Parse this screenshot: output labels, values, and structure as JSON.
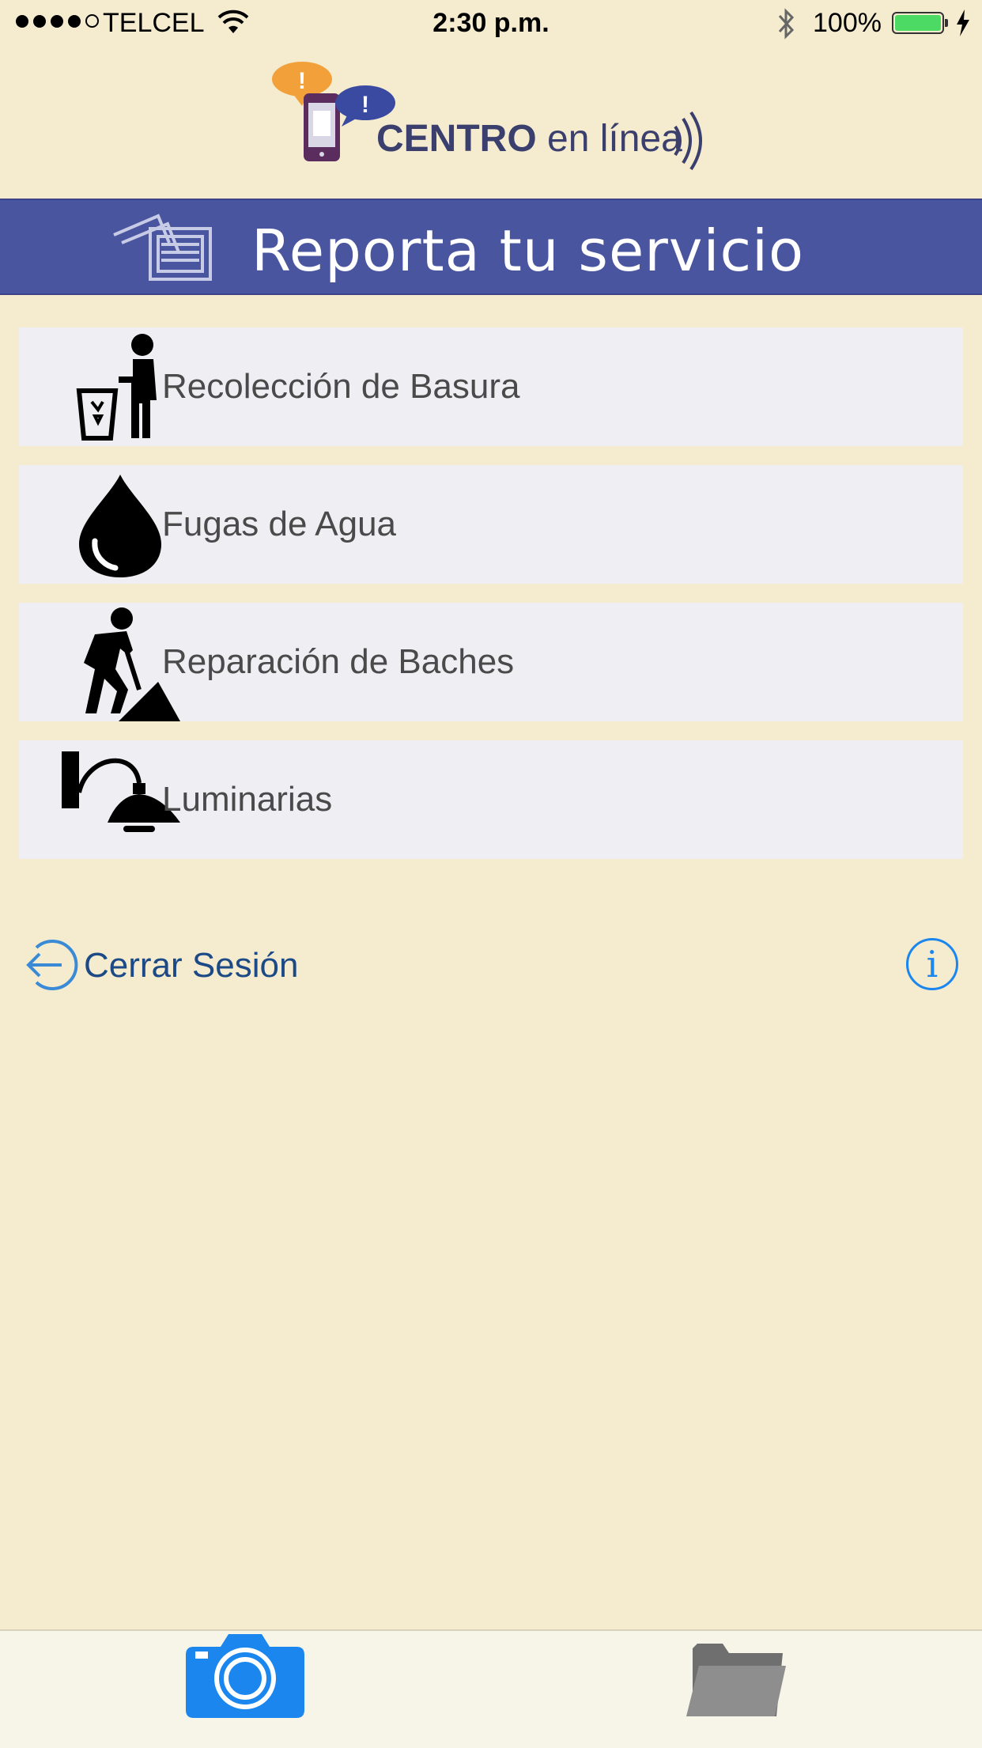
{
  "status_bar": {
    "carrier": "TELCEL",
    "time": "2:30 p.m.",
    "battery": "100%",
    "signal_bars_filled": 4,
    "signal_bars_total": 5
  },
  "header": {
    "logo_brand": "CENTRO",
    "logo_suffix": " en línea",
    "logo_icon": "phone-speech-bubbles-icon"
  },
  "banner": {
    "title": "Reporta tu servicio",
    "icon": "documents-icon",
    "color": "#4a55a0"
  },
  "services": [
    {
      "label": "Recolección de Basura",
      "icon": "trash-collector-icon"
    },
    {
      "label": "Fugas de Agua",
      "icon": "water-drop-icon"
    },
    {
      "label": "Reparación de Baches",
      "icon": "road-worker-icon"
    },
    {
      "label": "Luminarias",
      "icon": "street-lamp-icon"
    }
  ],
  "logout": {
    "label": "Cerrar Sesión",
    "icon": "logout-arrow-icon"
  },
  "info": {
    "glyph": "i",
    "icon": "info-icon"
  },
  "tab_bar": {
    "tabs": [
      {
        "name": "camera",
        "icon": "camera-icon",
        "color": "#1a86ee"
      },
      {
        "name": "folder",
        "icon": "folder-icon",
        "color": "#8e8e8e"
      }
    ]
  },
  "colors": {
    "background": "#f5ebcf",
    "accent": "#1a86ee",
    "logout_text": "#1c4a86"
  }
}
